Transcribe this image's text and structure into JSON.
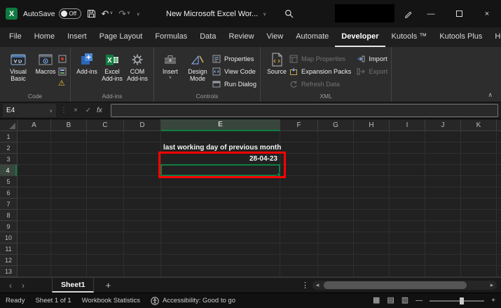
{
  "titlebar": {
    "autosave_label": "AutoSave",
    "autosave_state": "Off",
    "doc_title": "New Microsoft Excel Wor...",
    "minimize_glyph": "—",
    "close_glyph": "×"
  },
  "icons_glyphs": {
    "caret_down": "∨",
    "undo": "↶",
    "redo": "↷",
    "warning": "⚠",
    "dots_vertical": "⋮",
    "cancel": "×",
    "confirm": "✓",
    "fx": "fx",
    "nav_left": "‹",
    "nav_right": "›",
    "add": "+",
    "scroll_left": "◂",
    "scroll_right": "▸",
    "view_normal": "▦",
    "view_layout": "▤",
    "view_break": "▥",
    "zoom_out": "—",
    "zoom_in": "+",
    "collapse": "∧"
  },
  "tabs": {
    "items": [
      "File",
      "Home",
      "Insert",
      "Page Layout",
      "Formulas",
      "Data",
      "Review",
      "View",
      "Automate",
      "Developer",
      "Kutools ™",
      "Kutools Plus",
      "Help"
    ],
    "active": "Developer"
  },
  "ribbon": {
    "groups": {
      "code": {
        "label": "Code",
        "visual_basic": "Visual Basic",
        "macros": "Macros"
      },
      "addins": {
        "label": "Add-ins",
        "addins": "Add-ins",
        "excel_addins": "Excel Add-ins",
        "com_addins": "COM Add-ins"
      },
      "controls": {
        "label": "Controls",
        "insert": "Insert",
        "design_mode": "Design Mode",
        "properties": "Properties",
        "view_code": "View Code",
        "run_dialog": "Run Dialog"
      },
      "xml": {
        "label": "XML",
        "source": "Source",
        "map_properties": "Map Properties",
        "expansion_packs": "Expansion Packs",
        "refresh_data": "Refresh Data",
        "import": "Import",
        "export": "Export"
      }
    }
  },
  "formula_bar": {
    "name_box": "E4",
    "formula_value": ""
  },
  "grid": {
    "columns": [
      "A",
      "B",
      "C",
      "D",
      "E",
      "F",
      "G",
      "H",
      "I",
      "J",
      "K"
    ],
    "rows": [
      "1",
      "2",
      "3",
      "4",
      "5",
      "6",
      "7",
      "8",
      "9",
      "10",
      "11",
      "12",
      "13"
    ],
    "selected_column": "E",
    "active_cell": "E4",
    "cells": {
      "E2": "last working day of previous month",
      "E3": "28-04-23"
    }
  },
  "sheet_bar": {
    "sheet_name": "Sheet1"
  },
  "status_bar": {
    "ready": "Ready",
    "sheet_count": "Sheet 1 of 1",
    "workbook_statistics": "Workbook Statistics",
    "accessibility": "Accessibility: Good to go"
  },
  "colors": {
    "accent_green": "#107c41",
    "annotation_red": "#ff0000",
    "warning_yellow": "#f1c232"
  }
}
